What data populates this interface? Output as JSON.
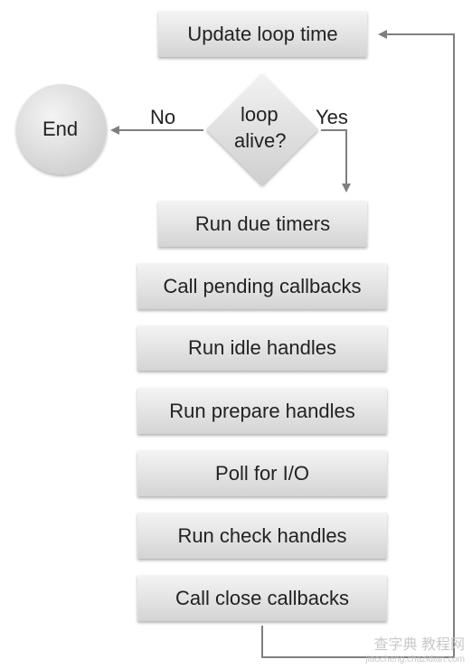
{
  "nodes": {
    "update_loop_time": "Update loop time",
    "loop_alive": [
      "loop",
      "alive?"
    ],
    "end": "End",
    "run_due_timers": "Run due timers",
    "call_pending_callbacks": "Call pending callbacks",
    "run_idle_handles": "Run idle handles",
    "run_prepare_handles": "Run prepare handles",
    "poll_for_io": "Poll for I/O",
    "run_check_handles": "Run check handles",
    "call_close_callbacks": "Call close callbacks"
  },
  "edges": {
    "no": "No",
    "yes": "Yes"
  },
  "colors": {
    "line": "#7d7f82",
    "box_top": "#f4f4f4",
    "box_bottom": "#d4d4d4"
  },
  "watermark": {
    "main": "查字典 教程网",
    "sub": "jiaocheng.chazidian.com"
  }
}
